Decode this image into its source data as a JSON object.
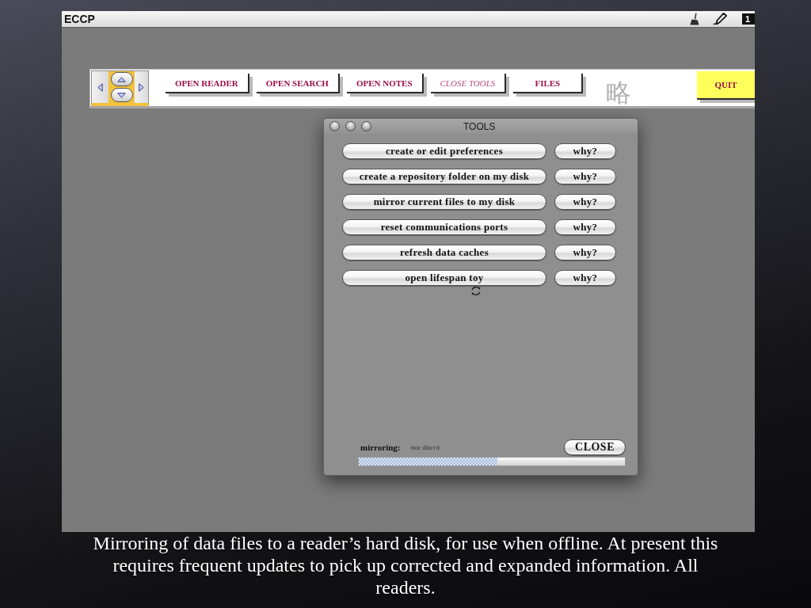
{
  "menu_bar": {
    "title": "ECCP",
    "status_icon_label": "1"
  },
  "toolbar": {
    "logo_text": "略",
    "buttons": [
      {
        "label": "OPEN READER",
        "selected": false
      },
      {
        "label": "OPEN SEARCH",
        "selected": false
      },
      {
        "label": "OPEN NOTES",
        "selected": false
      },
      {
        "label": "CLOSE TOOLS",
        "selected": true
      },
      {
        "label": "FILES",
        "selected": false
      }
    ],
    "quit_button": "QUIT"
  },
  "tools_window": {
    "title": "TOOLS",
    "tools": [
      {
        "label": "create or edit preferences",
        "help_button": "why?"
      },
      {
        "label": "create a repository folder on my disk",
        "help_button": "why?"
      },
      {
        "label": "mirror current files to my disk",
        "help_button": "why?"
      },
      {
        "label": "reset communications ports",
        "help_button": "why?"
      },
      {
        "label": "refresh data caches",
        "help_button": "why?"
      },
      {
        "label": "open lifespan toy",
        "help_button": "why?"
      }
    ],
    "status_label": "mirroring:",
    "status_detail": "mac diacrit",
    "close_button": "CLOSE",
    "progress": {
      "level": 0.52
    }
  },
  "caption": "Mirroring of data files to a reader’s hard disk, for use when offline. At present this requires frequent updates to pick up corrected and expanded information. All readers."
}
